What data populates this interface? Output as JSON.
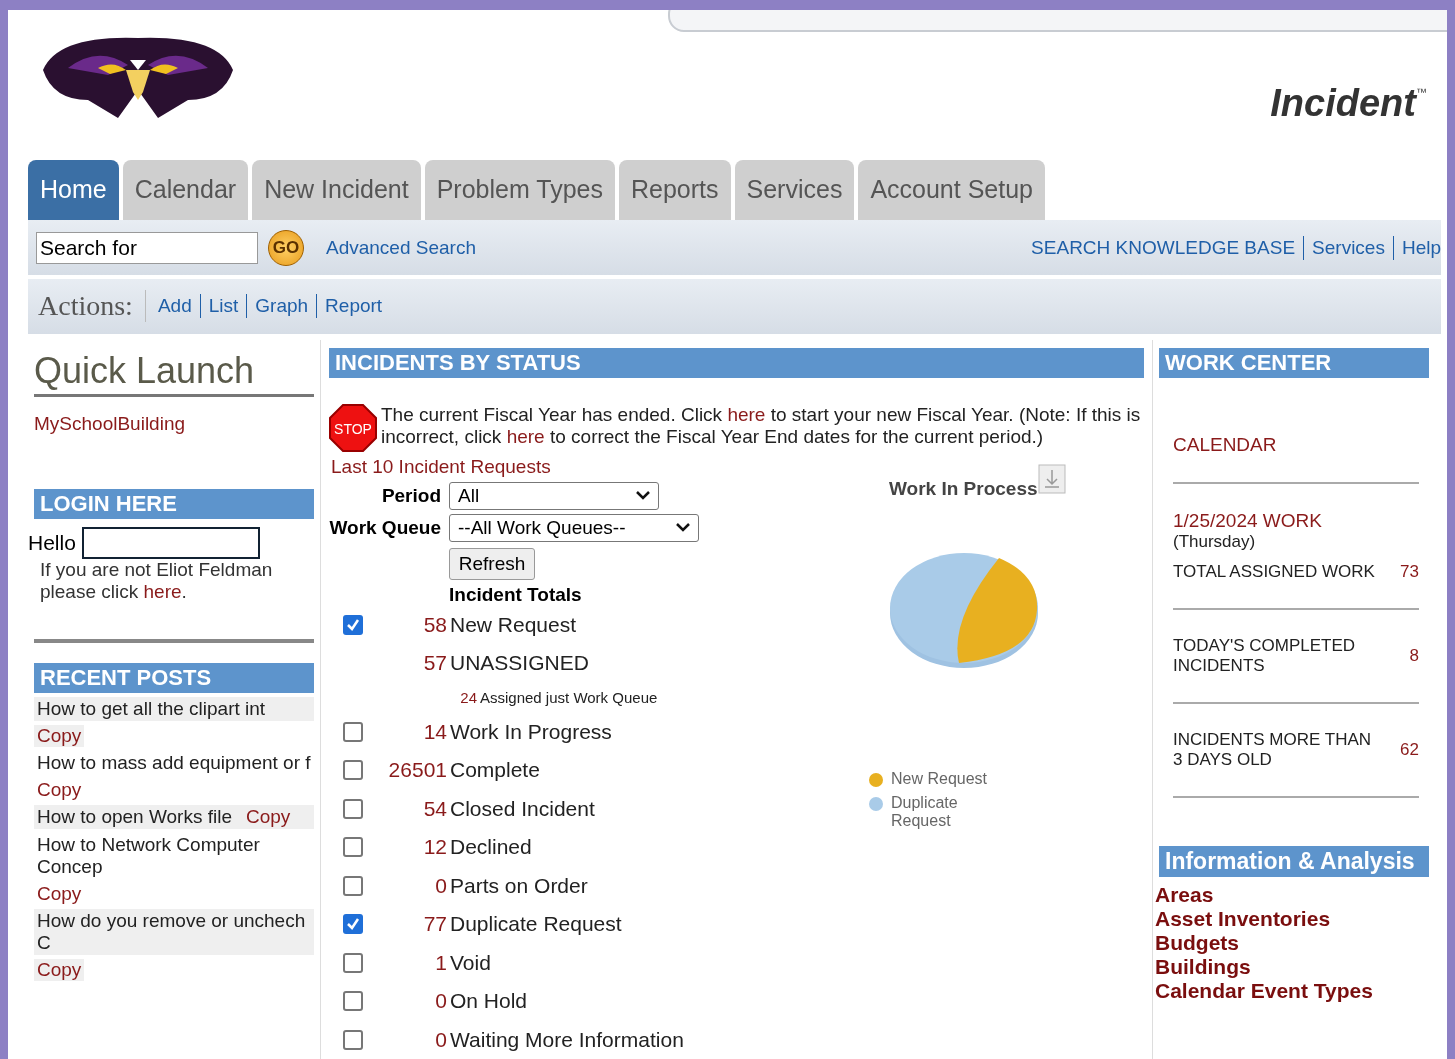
{
  "header": {
    "product": "Incident",
    "trademark": "™"
  },
  "tabs": [
    {
      "label": "Home",
      "selected": true
    },
    {
      "label": "Calendar",
      "selected": false
    },
    {
      "label": "New Incident",
      "selected": false
    },
    {
      "label": "Problem Types",
      "selected": false
    },
    {
      "label": "Reports",
      "selected": false
    },
    {
      "label": "Services",
      "selected": false
    },
    {
      "label": "Account Setup",
      "selected": false
    }
  ],
  "search": {
    "value": "Search for",
    "go": "GO",
    "advanced": "Advanced Search",
    "links": [
      "SEARCH KNOWLEDGE BASE",
      "Services",
      "Help"
    ]
  },
  "actions": {
    "label": "Actions:",
    "links": [
      "Add",
      "List",
      "Graph",
      "Report"
    ]
  },
  "quick_launch": {
    "title": "Quick Launch",
    "links": [
      "MySchoolBuilding"
    ]
  },
  "login": {
    "title": "LOGIN HERE",
    "hello": "Hello",
    "parts": [
      {
        "kind": "text",
        "text": "If you are not Eliot Feldman please click "
      },
      {
        "kind": "link",
        "text": "here"
      },
      {
        "kind": "text",
        "text": "."
      }
    ]
  },
  "recent_posts": {
    "title": "RECENT POSTS",
    "items": [
      {
        "title": "How to get all the clipart int",
        "copy": "Copy"
      },
      {
        "title": "How to mass add equipment or f",
        "copy": "Copy"
      },
      {
        "title": "How to open Works file",
        "copy": "Copy"
      },
      {
        "title": "How to Network Computer Concep",
        "copy": "Copy"
      },
      {
        "title": "How do you remove or unchech C",
        "copy": "Copy"
      }
    ]
  },
  "incidents": {
    "title": "INCIDENTS BY STATUS",
    "stop": "STOP",
    "notice": [
      {
        "kind": "text",
        "text": "The current Fiscal Year has ended. Click "
      },
      {
        "kind": "link",
        "text": "here"
      },
      {
        "kind": "text",
        "text": " to start your new Fiscal Year. (Note: If this is incorrect, click "
      },
      {
        "kind": "link",
        "text": "here"
      },
      {
        "kind": "text",
        "text": " to correct the Fiscal Year End dates for the current period.)"
      }
    ],
    "last_link": "Last 10 Incident Requests",
    "period": {
      "label": "Period",
      "value": "All"
    },
    "work_queue": {
      "label": "Work Queue",
      "value": "--All Work Queues--"
    },
    "refresh": "Refresh",
    "totals_title": "Incident Totals",
    "rows": [
      {
        "kind": "check",
        "checked": true,
        "count": "58",
        "label": "New Request"
      },
      {
        "kind": "plain",
        "count": "57",
        "label": "UNASSIGNED"
      },
      {
        "kind": "sub",
        "count": "24",
        "label": "Assigned just Work Queue"
      },
      {
        "kind": "check",
        "checked": false,
        "count": "14",
        "label": "Work In Progress"
      },
      {
        "kind": "check",
        "checked": false,
        "count": "26501",
        "label": "Complete"
      },
      {
        "kind": "check",
        "checked": false,
        "count": "54",
        "label": "Closed Incident"
      },
      {
        "kind": "check",
        "checked": false,
        "count": "12",
        "label": "Declined"
      },
      {
        "kind": "check",
        "checked": false,
        "count": "0",
        "label": "Parts on Order"
      },
      {
        "kind": "check",
        "checked": true,
        "count": "77",
        "label": "Duplicate Request"
      },
      {
        "kind": "check",
        "checked": false,
        "count": "1",
        "label": "Void"
      },
      {
        "kind": "check",
        "checked": false,
        "count": "0",
        "label": "On Hold"
      },
      {
        "kind": "check",
        "checked": false,
        "count": "0",
        "label": "Waiting More Information"
      }
    ],
    "chart": {
      "title": "Work In Process",
      "legend": [
        {
          "label": "New Request",
          "color": "#e8b020"
        },
        {
          "label": "Duplicate Request",
          "color": "#a9cbe8"
        }
      ]
    }
  },
  "work_center": {
    "title": "WORK CENTER",
    "calendar": "CALENDAR",
    "date": "1/25/2024 WORK",
    "day": "(Thursday)",
    "stats": [
      {
        "label": "TOTAL ASSIGNED WORK",
        "value": "73"
      },
      {
        "label": "TODAY'S COMPLETED INCIDENTS",
        "value": "8"
      },
      {
        "label": "INCIDENTS MORE THAN 3 DAYS OLD",
        "value": "62"
      }
    ]
  },
  "info": {
    "title": "Information & Analysis",
    "links": [
      "Areas",
      "Asset Inventories",
      "Budgets",
      "Buildings",
      "Calendar Event Types"
    ]
  }
}
